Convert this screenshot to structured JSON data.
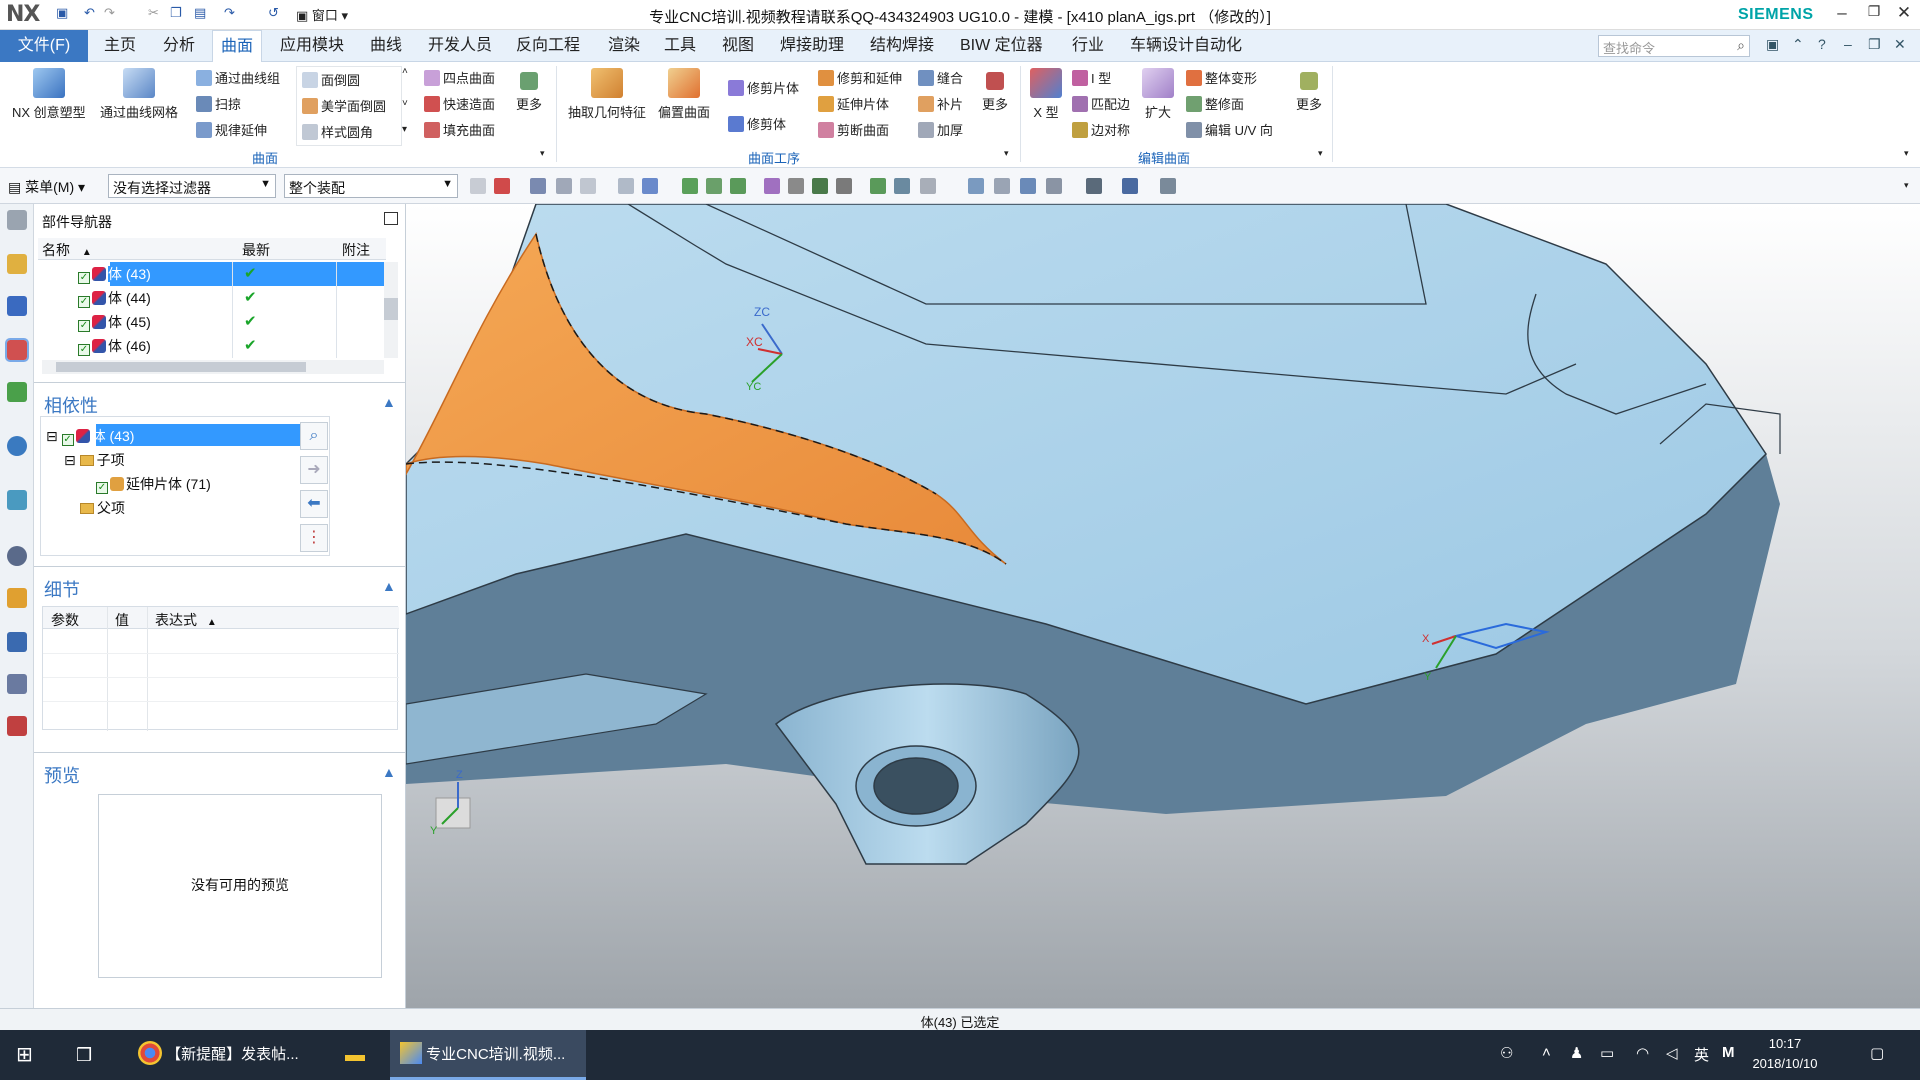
{
  "titlebar": {
    "logo": "NX",
    "window_menu": "窗口",
    "title": "专业CNC培训.视频教程请联系QQ-434324903 UG10.0 - 建模 - [x410 planA_igs.prt （修改的）]",
    "brand": "SIEMENS"
  },
  "menubar": {
    "file_tab": "文件(F)",
    "tabs": [
      "主页",
      "分析",
      "曲面",
      "应用模块",
      "曲线",
      "开发人员",
      "反向工程",
      "渲染",
      "工具",
      "视图",
      "焊接助理",
      "结构焊接",
      "BIW 定位器",
      "行业",
      "车辆设计自动化"
    ],
    "active_tab": "曲面",
    "search_placeholder": "查找命令"
  },
  "ribbon": {
    "group1": {
      "label": "曲面",
      "big": [
        "NX 创意塑型",
        "通过曲线网格"
      ],
      "col1": [
        "通过曲线组",
        "扫掠",
        "规律延伸"
      ],
      "col2": [
        "面倒圆",
        "美学面倒圆",
        "样式圆角"
      ],
      "col3": [
        "四点曲面",
        "快速造面",
        "填充曲面"
      ],
      "more": "更多"
    },
    "group2": {
      "label": "曲面工序",
      "big": [
        "抽取几何特征",
        "偏置曲面"
      ],
      "col1": [
        "修剪片体",
        "修剪体"
      ],
      "col2": [
        "修剪和延伸",
        "延伸片体",
        "剪断曲面"
      ],
      "col3": [
        "缝合",
        "补片",
        "加厚"
      ],
      "more": "更多"
    },
    "group3": {
      "label": "编辑曲面",
      "big": [
        "X 型",
        "扩大"
      ],
      "col1": [
        "I 型",
        "匹配边",
        "边对称"
      ],
      "col2": [
        "整体变形",
        "整修面",
        "编辑 U/V 向"
      ],
      "more": "更多"
    }
  },
  "toolbar": {
    "menu_label": "菜单(M)",
    "filter": "没有选择过滤器",
    "scope": "整个装配"
  },
  "part_navigator": {
    "title": "部件导航器",
    "columns": [
      "名称",
      "最新",
      "附注"
    ],
    "rows": [
      {
        "name": "体 (43)",
        "latest": "✔"
      },
      {
        "name": "体 (44)",
        "latest": "✔"
      },
      {
        "name": "体 (45)",
        "latest": "✔"
      },
      {
        "name": "体 (46)",
        "latest": "✔"
      }
    ]
  },
  "dependencies": {
    "title": "相依性",
    "root": "体 (43)",
    "children_label": "子项",
    "child_item": "延伸片体 (71)",
    "parents_label": "父项"
  },
  "details": {
    "title": "细节",
    "columns": [
      "参数",
      "值",
      "表达式"
    ]
  },
  "preview": {
    "title": "预览",
    "empty_text": "没有可用的预览"
  },
  "viewport": {
    "csys_labels": {
      "zc": "ZC",
      "xc": "XC",
      "yc": "YC",
      "x": "X",
      "y": "Y",
      "z": "Z"
    },
    "colors": {
      "model": "#a9cfe6",
      "model_dark": "#5f7f98",
      "selected": "#f0a050"
    }
  },
  "statusbar": {
    "message": "体(43) 已选定"
  },
  "taskbar": {
    "items": [
      "【新提醒】发表帖...",
      "专业CNC培训.视频..."
    ],
    "ime": "英",
    "time": "10:17",
    "date": "2018/10/10"
  }
}
